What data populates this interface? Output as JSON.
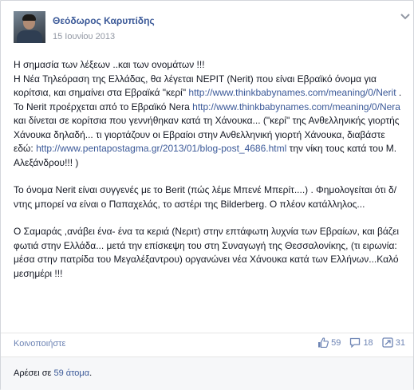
{
  "post": {
    "author": "Θεόδωρος Καρυπίδης",
    "date": "15 Ιουνίου 2013",
    "paragraph1": {
      "line1": "Η σημασία των λέξεων ..και των ονομάτων !!!",
      "line2": "Η Νέα Τηλεόραση της Ελλάδας, θα λέγεται ΝΕΡΙΤ (Nerit) που είναι Εβραϊκό όνομα για κορίτσια, και σημαίνει στα Εβραϊκά \"κερί\" ",
      "link1": "http://www.thinkbabynames.com/meaning/0/Nerit",
      "text2": " . Το Nerit προέρχεται από το Εβραϊκό Nera ",
      "link2": "http://www.thinkbabynames.com/meaning/0/Nera",
      "text3": " και δίνεται σε κορίτσια που γεννήθηκαν κατά τη Χάνουκα... (\"κερί\" της Ανθελληνικής γιορτής Χάνουκα δηλαδή... τι γιορτάζουν οι Εβραίοι στην Ανθελληνική γιορτή Χάνουκα, διαβάστε εδώ: ",
      "link3": "http://www.pentapostagma.gr/2013/01/blog-post_4686.html",
      "text4": " την νίκη τους κατά του Μ. Αλεξάνδρου!!! )"
    },
    "paragraph2": "Το όνομα Nerit είναι συγγενές με το Berit (πώς λέμε Μπενέ Μπερίτ....) . Φημολογείται ότι δ/ντης μπορεί να είναι ο Παπαχελάς, το αστέρι της Bilderberg. Ο πλέον κατάλληλος...",
    "paragraph3": "Ο Σαμαράς ,ανάβει ένα- ένα τα κεριά (Νεριτ) στην επτάφωτη λυχνία των Εβραίων, και βάζει φωτιά στην Ελλάδα... μετά την επίσκεψη του στη Συναγωγή της Θεσσαλονίκης, (τι ειρωνία: μέσα στην πατρίδα του Μεγαλέξαντρου) οργανώνει νέα Χάνουκα κατά των Ελλήνων...Καλό μεσημέρι !!!"
  },
  "actions": {
    "share_label": "Κοινοποιήστε",
    "likes_count": "59",
    "comments_count": "18",
    "shares_count": "31"
  },
  "likes_bar": {
    "prefix": "Αρέσει σε ",
    "count_link": "59 άτομα",
    "suffix": "."
  },
  "icons": {
    "menu": "chevron-down-icon",
    "like": "thumbs-up-icon",
    "comment": "comment-icon",
    "share": "share-icon"
  },
  "colors": {
    "link": "#3b5998",
    "text": "#141823",
    "meta": "#9197a3"
  }
}
